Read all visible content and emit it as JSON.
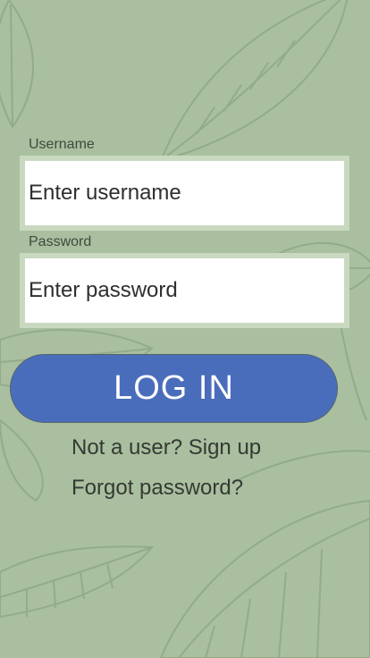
{
  "form": {
    "username": {
      "label": "Username",
      "placeholder": "Enter username",
      "value": ""
    },
    "password": {
      "label": "Password",
      "placeholder": "Enter password",
      "value": ""
    }
  },
  "actions": {
    "login_label": "LOG IN",
    "signup_link": "Not a user? Sign up",
    "forgot_link": "Forgot password?"
  },
  "colors": {
    "background": "#a9bf9f",
    "leaf_stroke": "#8fa886",
    "button": "#4a6dbb",
    "button_text": "#ffffff",
    "input_frame": "#c9d9c0"
  }
}
